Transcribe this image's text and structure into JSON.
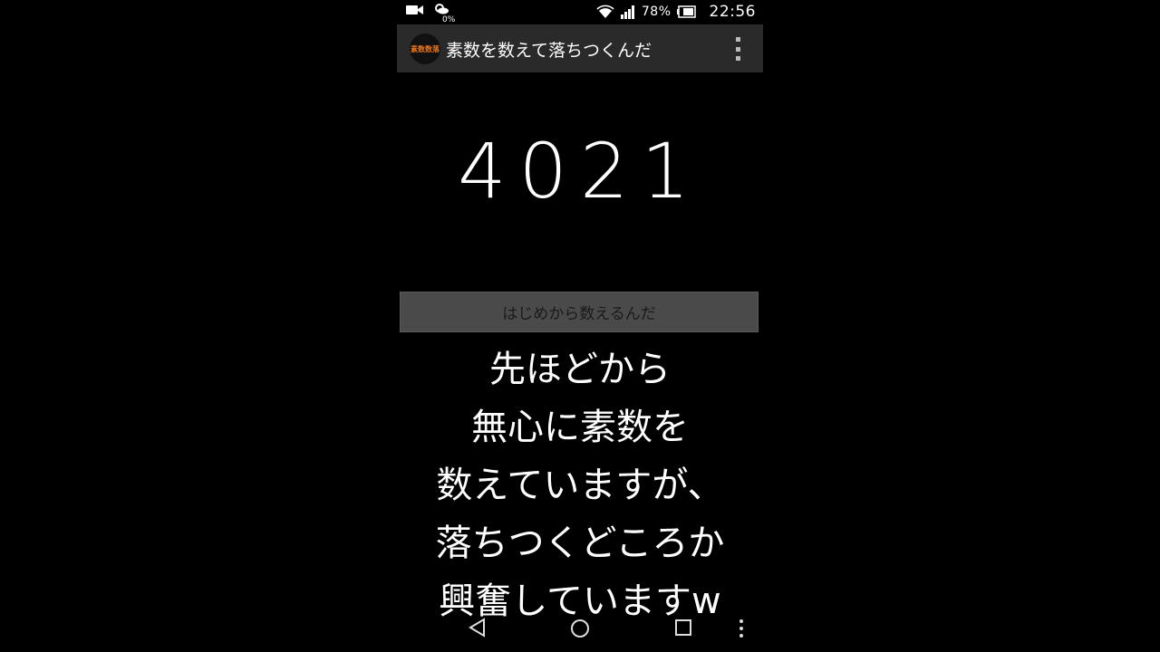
{
  "status_bar": {
    "weather_percent": "0%",
    "battery_percent": "78%",
    "time": "22:56",
    "icons": [
      "video-camera-icon",
      "weather-icon",
      "wifi-icon",
      "signal-icon",
      "battery-icon"
    ]
  },
  "app_bar": {
    "logo_text": "素数数落",
    "title": "素数を数えて落ちつくんだ",
    "menu_icon": "overflow-menu-icon"
  },
  "main": {
    "counter": "4021",
    "restart_button_label": "はじめから数えるんだ"
  },
  "caption": {
    "lines": [
      "先ほどから",
      "無心に素数を",
      "数えていますが、",
      "落ちつくどころか",
      "興奮していますw"
    ]
  },
  "nav_bar": {
    "icons": [
      "back-icon",
      "home-icon",
      "recent-apps-icon",
      "more-icon"
    ]
  },
  "colors": {
    "background": "#000000",
    "app_bar": "#2a2a2a",
    "button": "#4a4a4a",
    "logo_text": "#e8751a"
  }
}
